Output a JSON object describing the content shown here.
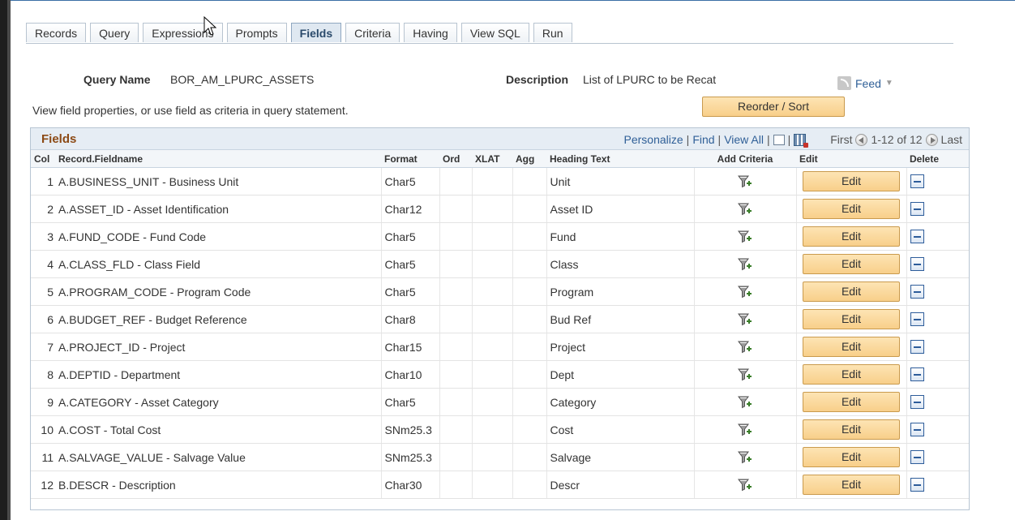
{
  "tabs": [
    {
      "label": "Records"
    },
    {
      "label": "Query"
    },
    {
      "label": "Expressions"
    },
    {
      "label": "Prompts"
    },
    {
      "label": "Fields",
      "active": true
    },
    {
      "label": "Criteria"
    },
    {
      "label": "Having"
    },
    {
      "label": "View SQL"
    },
    {
      "label": "Run"
    }
  ],
  "query": {
    "name_label": "Query Name",
    "name_value": "BOR_AM_LPURC_ASSETS",
    "description_label": "Description",
    "description_value": "List of LPURC to be Recat"
  },
  "feed": {
    "label": "Feed",
    "icon": "rss-feed-icon"
  },
  "help_text": "View field properties, or use field as criteria in query statement.",
  "reorder_button": "Reorder / Sort",
  "grid": {
    "title": "Fields",
    "nav": {
      "personalize": "Personalize",
      "find": "Find",
      "view_all": "View All",
      "first": "First",
      "range": "1-12 of 12",
      "last": "Last"
    },
    "columns": {
      "col": "Col",
      "record_fieldname": "Record.Fieldname",
      "format": "Format",
      "ord": "Ord",
      "xlat": "XLAT",
      "agg": "Agg",
      "heading_text": "Heading Text",
      "add_criteria": "Add Criteria",
      "edit": "Edit",
      "delete": "Delete"
    },
    "edit_label": "Edit",
    "rows": [
      {
        "col": "1",
        "field": "A.BUSINESS_UNIT - Business Unit",
        "format": "Char5",
        "ord": "",
        "xlat": "",
        "agg": "",
        "heading": "Unit"
      },
      {
        "col": "2",
        "field": "A.ASSET_ID - Asset Identification",
        "format": "Char12",
        "ord": "",
        "xlat": "",
        "agg": "",
        "heading": "Asset ID"
      },
      {
        "col": "3",
        "field": "A.FUND_CODE - Fund Code",
        "format": "Char5",
        "ord": "",
        "xlat": "",
        "agg": "",
        "heading": "Fund"
      },
      {
        "col": "4",
        "field": "A.CLASS_FLD - Class Field",
        "format": "Char5",
        "ord": "",
        "xlat": "",
        "agg": "",
        "heading": "Class"
      },
      {
        "col": "5",
        "field": "A.PROGRAM_CODE - Program Code",
        "format": "Char5",
        "ord": "",
        "xlat": "",
        "agg": "",
        "heading": "Program"
      },
      {
        "col": "6",
        "field": "A.BUDGET_REF - Budget Reference",
        "format": "Char8",
        "ord": "",
        "xlat": "",
        "agg": "",
        "heading": "Bud Ref"
      },
      {
        "col": "7",
        "field": "A.PROJECT_ID - Project",
        "format": "Char15",
        "ord": "",
        "xlat": "",
        "agg": "",
        "heading": "Project"
      },
      {
        "col": "8",
        "field": "A.DEPTID - Department",
        "format": "Char10",
        "ord": "",
        "xlat": "",
        "agg": "",
        "heading": "Dept"
      },
      {
        "col": "9",
        "field": "A.CATEGORY - Asset Category",
        "format": "Char5",
        "ord": "",
        "xlat": "",
        "agg": "",
        "heading": "Category"
      },
      {
        "col": "10",
        "field": "A.COST - Total Cost",
        "format": "SNm25.3",
        "ord": "",
        "xlat": "",
        "agg": "",
        "heading": "Cost"
      },
      {
        "col": "11",
        "field": "A.SALVAGE_VALUE - Salvage Value",
        "format": "SNm25.3",
        "ord": "",
        "xlat": "",
        "agg": "",
        "heading": "Salvage"
      },
      {
        "col": "12",
        "field": "B.DESCR - Description",
        "format": "Char30",
        "ord": "",
        "xlat": "",
        "agg": "",
        "heading": "Descr"
      }
    ]
  },
  "colors": {
    "accent": "#2f5f97",
    "grid_title": "#8c4a15",
    "button": "#f8cf8a"
  }
}
